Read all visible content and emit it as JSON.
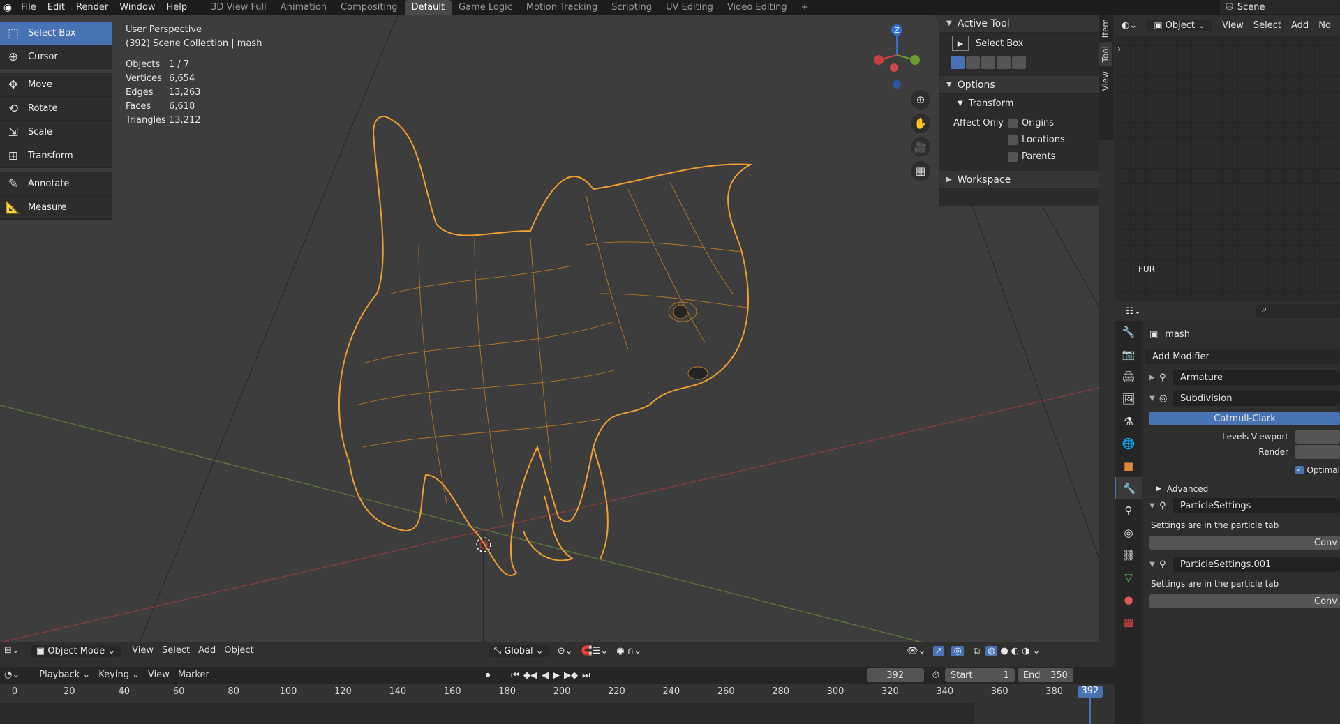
{
  "topbar": {
    "menu": [
      "File",
      "Edit",
      "Render",
      "Window",
      "Help"
    ],
    "workspaces": [
      "3D View Full",
      "Animation",
      "Compositing",
      "Default",
      "Game Logic",
      "Motion Tracking",
      "Scripting",
      "UV Editing",
      "Video Editing"
    ],
    "active_workspace": "Default",
    "add_tab": "+",
    "scene": "Scene"
  },
  "viewport": {
    "perspective": "User Perspective",
    "collection": "(392) Scene Collection | mash",
    "stats": [
      {
        "k": "Objects",
        "v": "1 / 7"
      },
      {
        "k": "Vertices",
        "v": "6,654"
      },
      {
        "k": "Edges",
        "v": "13,263"
      },
      {
        "k": "Faces",
        "v": "6,618"
      },
      {
        "k": "Triangles",
        "v": "13,212"
      }
    ],
    "gizmo_axis_label": "Z"
  },
  "toolbar": {
    "tools": [
      {
        "name": "Select Box",
        "icon": "select-box-icon",
        "glyph": "⬚"
      },
      {
        "name": "Cursor",
        "icon": "cursor-icon",
        "glyph": "⊕"
      },
      {
        "name": "Move",
        "icon": "move-icon",
        "glyph": "✥"
      },
      {
        "name": "Rotate",
        "icon": "rotate-icon",
        "glyph": "⟲"
      },
      {
        "name": "Scale",
        "icon": "scale-icon",
        "glyph": "⇲"
      },
      {
        "name": "Transform",
        "icon": "transform-icon",
        "glyph": "⊞"
      },
      {
        "name": "Annotate",
        "icon": "annotate-icon",
        "glyph": "✎"
      },
      {
        "name": "Measure",
        "icon": "measure-icon",
        "glyph": "📐"
      }
    ],
    "active": "Select Box"
  },
  "npanel": {
    "active_tool_title": "Active Tool",
    "active_tool_name": "Select Box",
    "options_title": "Options",
    "transform_title": "Transform",
    "affect_only": "Affect Only",
    "checks": [
      "Origins",
      "Locations",
      "Parents"
    ],
    "workspace_title": "Workspace",
    "tabs": [
      "Item",
      "Tool",
      "View"
    ]
  },
  "outliner_header": {
    "mode": "Object",
    "menus": [
      "View",
      "Select",
      "Add",
      "No"
    ],
    "fur_label": "FUR"
  },
  "properties": {
    "object_name": "mash",
    "add_modifier": "Add Modifier",
    "modifiers": [
      {
        "name": "Armature",
        "expanded": false
      },
      {
        "name": "Subdivision",
        "expanded": true
      }
    ],
    "subdiv_type": "Catmull-Clark",
    "levels_viewport": "Levels Viewport",
    "render": "Render",
    "optimal": "Optimal",
    "advanced": "Advanced",
    "particle1": "ParticleSettings",
    "particle1_note": "Settings are in the particle tab",
    "particle2": "ParticleSettings.001",
    "particle2_note": "Settings are in the particle tab",
    "convert": "Conv"
  },
  "header3d": {
    "mode": "Object Mode",
    "menus": [
      "View",
      "Select",
      "Add",
      "Object"
    ],
    "orientation": "Global"
  },
  "timeline": {
    "menus": [
      "Playback",
      "Keying",
      "View",
      "Marker"
    ],
    "current_frame": "392",
    "start_label": "Start",
    "start": "1",
    "end_label": "End",
    "end": "350",
    "ticks": [
      "0",
      "20",
      "40",
      "60",
      "80",
      "100",
      "120",
      "140",
      "160",
      "180",
      "200",
      "220",
      "240",
      "260",
      "280",
      "300",
      "320",
      "340",
      "360",
      "380"
    ],
    "playhead": "392"
  },
  "colors": {
    "accent": "#4772b3",
    "wire": "#f0a030",
    "axis_x": "#b34545",
    "axis_y": "#6b8f3a"
  }
}
